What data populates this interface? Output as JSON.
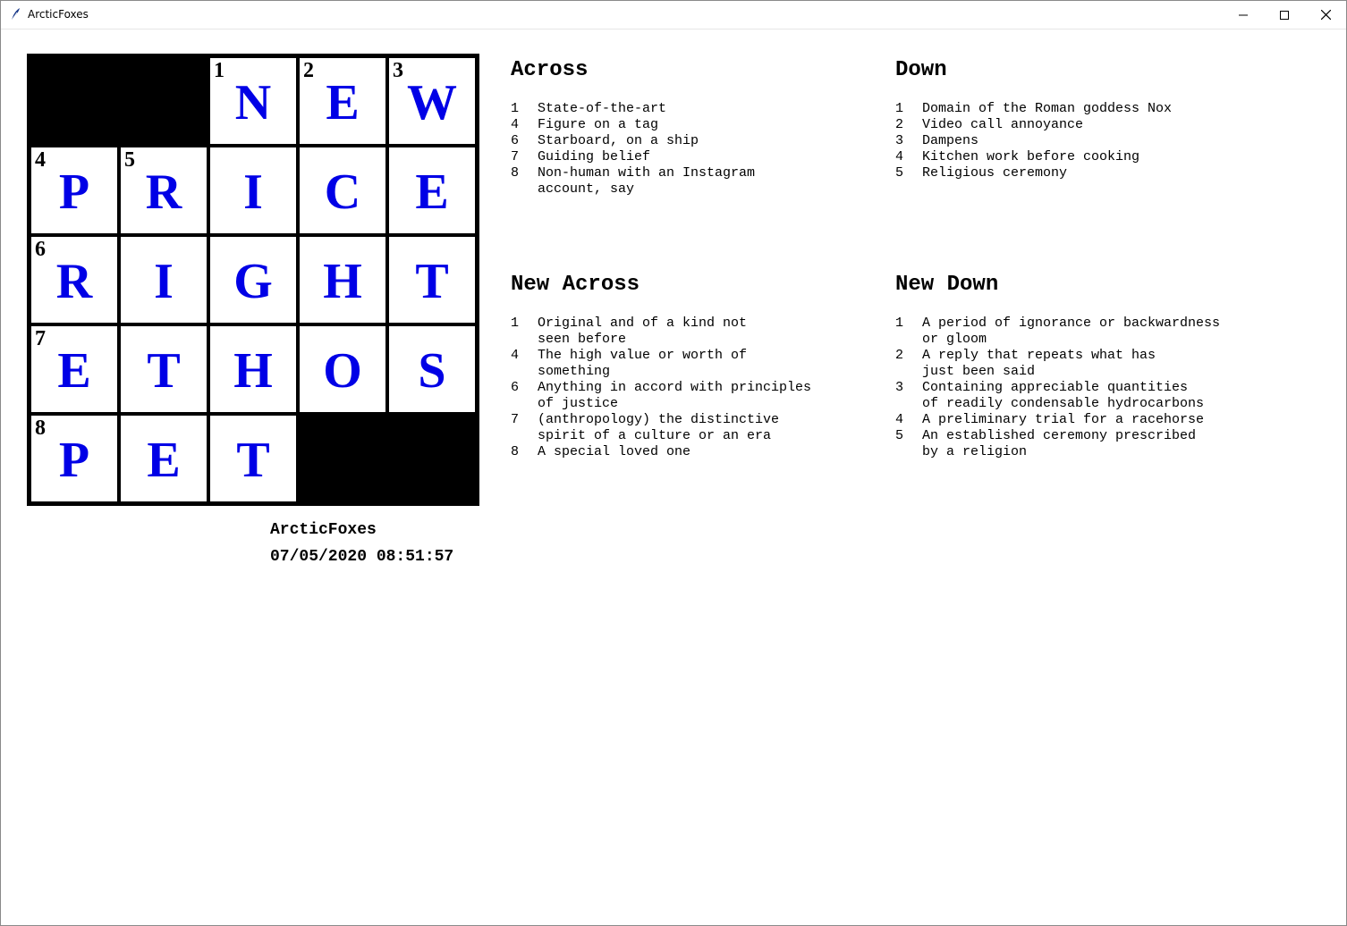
{
  "window": {
    "title": "ArcticFoxes"
  },
  "grid": {
    "rows": [
      [
        {
          "black": true
        },
        {
          "black": true
        },
        {
          "num": "1",
          "letter": "N"
        },
        {
          "num": "2",
          "letter": "E"
        },
        {
          "num": "3",
          "letter": "W"
        }
      ],
      [
        {
          "num": "4",
          "letter": "P"
        },
        {
          "num": "5",
          "letter": "R"
        },
        {
          "letter": "I"
        },
        {
          "letter": "C"
        },
        {
          "letter": "E"
        }
      ],
      [
        {
          "num": "6",
          "letter": "R"
        },
        {
          "letter": "I"
        },
        {
          "letter": "G"
        },
        {
          "letter": "H"
        },
        {
          "letter": "T"
        }
      ],
      [
        {
          "num": "7",
          "letter": "E"
        },
        {
          "letter": "T"
        },
        {
          "letter": "H"
        },
        {
          "letter": "O"
        },
        {
          "letter": "S"
        }
      ],
      [
        {
          "num": "8",
          "letter": "P"
        },
        {
          "letter": "E"
        },
        {
          "letter": "T"
        },
        {
          "black": true
        },
        {
          "black": true
        }
      ]
    ],
    "letter_color": "#0000e6"
  },
  "meta": {
    "name": "ArcticFoxes",
    "datetime": "07/05/2020 08:51:57"
  },
  "clues": {
    "across": {
      "heading": "Across",
      "items": [
        {
          "num": "1",
          "lines": [
            "State-of-the-art"
          ]
        },
        {
          "num": "4",
          "lines": [
            "Figure on a tag"
          ]
        },
        {
          "num": "6",
          "lines": [
            "Starboard, on a ship"
          ]
        },
        {
          "num": "7",
          "lines": [
            "Guiding belief"
          ]
        },
        {
          "num": "8",
          "lines": [
            "Non-human with an Instagram",
            "account, say"
          ]
        }
      ]
    },
    "down": {
      "heading": "Down",
      "items": [
        {
          "num": "1",
          "lines": [
            "Domain of the Roman goddess Nox"
          ]
        },
        {
          "num": "2",
          "lines": [
            "Video call annoyance"
          ]
        },
        {
          "num": "3",
          "lines": [
            "Dampens"
          ]
        },
        {
          "num": "4",
          "lines": [
            "Kitchen work before cooking"
          ]
        },
        {
          "num": "5",
          "lines": [
            "Religious ceremony"
          ]
        }
      ]
    },
    "new_across": {
      "heading": "New Across",
      "items": [
        {
          "num": "1",
          "lines": [
            "Original and of a kind not",
            "seen before"
          ]
        },
        {
          "num": "4",
          "lines": [
            "The high value or worth of",
            "something"
          ]
        },
        {
          "num": "6",
          "lines": [
            "Anything in accord with principles",
            "of justice"
          ]
        },
        {
          "num": "7",
          "lines": [
            "(anthropology) the distinctive",
            "spirit of a culture or an era"
          ]
        },
        {
          "num": "8",
          "lines": [
            "A special loved one"
          ]
        }
      ]
    },
    "new_down": {
      "heading": "New Down",
      "items": [
        {
          "num": "1",
          "lines": [
            "A period of ignorance or backwardness",
            "or gloom"
          ]
        },
        {
          "num": "2",
          "lines": [
            "A reply that repeats what has",
            "just been said"
          ]
        },
        {
          "num": "3",
          "lines": [
            "Containing appreciable quantities",
            "of readily condensable hydrocarbons"
          ]
        },
        {
          "num": "4",
          "lines": [
            "A preliminary trial for a racehorse"
          ]
        },
        {
          "num": "5",
          "lines": [
            "An established ceremony prescribed",
            "by a religion"
          ]
        }
      ]
    }
  }
}
